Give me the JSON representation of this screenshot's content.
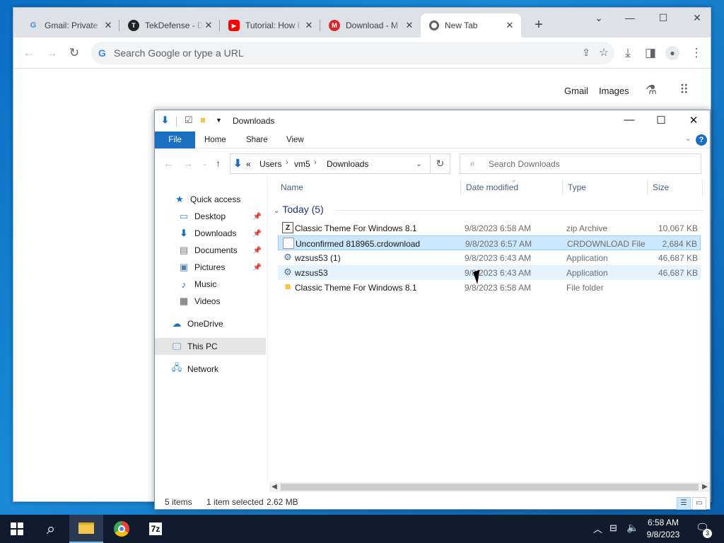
{
  "browser": {
    "tabs": [
      {
        "title": "Gmail: Private",
        "icon": "google-icon"
      },
      {
        "title": "TekDefense - D",
        "icon": "tekdefense-icon"
      },
      {
        "title": "Tutorial: How I",
        "icon": "youtube-icon"
      },
      {
        "title": "Download - M",
        "icon": "mega-icon"
      },
      {
        "title": "New Tab",
        "icon": "chrome-icon",
        "active": true
      }
    ],
    "omnibox_placeholder": "Search Google or type a URL",
    "ntp_links": {
      "gmail": "Gmail",
      "images": "Images"
    }
  },
  "explorer": {
    "title": "Downloads",
    "ribbon_tabs": [
      "File",
      "Home",
      "Share",
      "View"
    ],
    "address": {
      "prefix": "«",
      "segments": [
        "Users",
        "vm5",
        "Downloads"
      ]
    },
    "search_placeholder": "Search Downloads",
    "nav": {
      "quick_access": "Quick access",
      "items": [
        {
          "label": "Desktop",
          "pinned": true,
          "icon": "desktop-icon"
        },
        {
          "label": "Downloads",
          "pinned": true,
          "icon": "downloads-icon"
        },
        {
          "label": "Documents",
          "pinned": true,
          "icon": "documents-icon"
        },
        {
          "label": "Pictures",
          "pinned": true,
          "icon": "pictures-icon"
        },
        {
          "label": "Music",
          "pinned": false,
          "icon": "music-icon"
        },
        {
          "label": "Videos",
          "pinned": false,
          "icon": "videos-icon"
        }
      ],
      "onedrive": "OneDrive",
      "this_pc": "This PC",
      "network": "Network"
    },
    "columns": {
      "name": "Name",
      "date": "Date modified",
      "type": "Type",
      "size": "Size"
    },
    "group_label": "Today (5)",
    "files": [
      {
        "name": "Classic Theme For Windows 8.1",
        "date": "9/8/2023 6:58 AM",
        "type": "zip Archive",
        "size": "10,067 KB",
        "icon": "zip-icon"
      },
      {
        "name": "Unconfirmed 818965.crdownload",
        "date": "9/8/2023 6:57 AM",
        "type": "CRDOWNLOAD File",
        "size": "2,684 KB",
        "icon": "file-icon",
        "selected": true
      },
      {
        "name": "wzsus53 (1)",
        "date": "9/8/2023 6:43 AM",
        "type": "Application",
        "size": "46,687 KB",
        "icon": "application-icon"
      },
      {
        "name": "wzsus53",
        "date": "9/8/2023 6:43 AM",
        "type": "Application",
        "size": "46,687 KB",
        "icon": "application-icon",
        "hover": true
      },
      {
        "name": "Classic Theme For Windows 8.1",
        "date": "9/8/2023 6:58 AM",
        "type": "File folder",
        "size": "",
        "icon": "folder-icon"
      }
    ],
    "status": {
      "count": "5 items",
      "selected": "1 item selected",
      "size": "2.62 MB"
    }
  },
  "taskbar": {
    "apps": [
      "file-explorer-icon",
      "chrome-icon",
      "7zip-icon"
    ],
    "time": "6:58 AM",
    "date": "9/8/2023",
    "notifications": "3"
  },
  "colors": {
    "accent": "#1a6fc0",
    "selection": "#cce8ff",
    "taskbar": "#101b2e"
  }
}
